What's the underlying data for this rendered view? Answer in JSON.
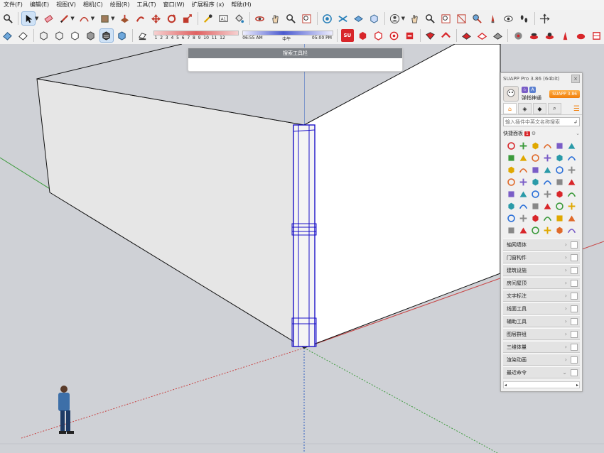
{
  "menu": [
    "文件(F)",
    "编辑(E)",
    "视图(V)",
    "相机(C)",
    "绘图(R)",
    "工具(T)",
    "窗口(W)",
    "扩展程序 (x)",
    "帮助(H)"
  ],
  "shadow": {
    "months": "1  2  3  4  5  6  7  8  9  10  11  12",
    "time_start": "06:55 AM",
    "time_mid": "中午",
    "time_end": "05:00 PM"
  },
  "search_toolbar": {
    "title": "搜索工具栏"
  },
  "panel": {
    "title": "SUAPP Pro 3.86 (64bit)",
    "close": "×",
    "user_name": "弹指神通",
    "version_button": "SUAPP 3.86",
    "search_placeholder": "输入插件中英文名称搜索",
    "quick_label": "快捷面板",
    "quick_badge": "1",
    "categories": [
      "轴网墙体",
      "门窗构件",
      "建筑设施",
      "房间屋顶",
      "文字标注",
      "线面工具",
      "辅助工具",
      "图层群组",
      "三维体量",
      "渲染动画",
      "最近命令"
    ],
    "scroll_left": "◂",
    "scroll_right": "▸"
  },
  "colors": {
    "accent": "#f07e0a",
    "selection": "#1a10c8",
    "axis_green": "#3b9a3b",
    "axis_red": "#c84444",
    "axis_blue": "#3060c0"
  }
}
